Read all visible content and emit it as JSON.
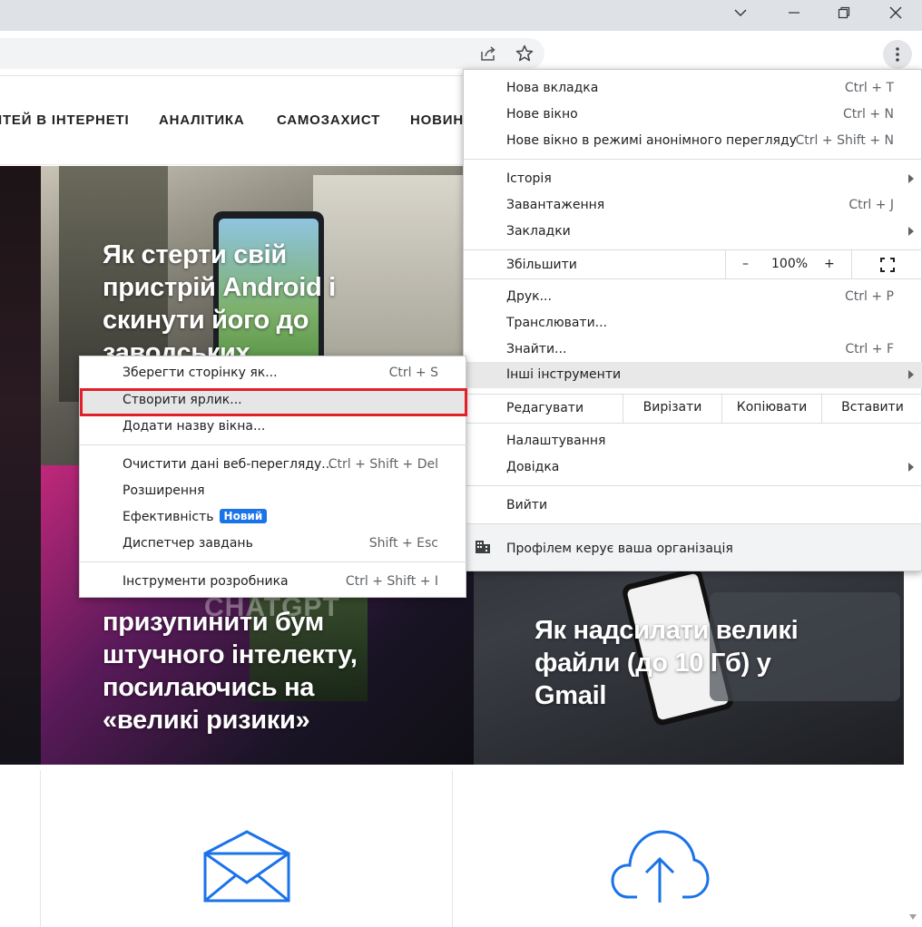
{
  "site_nav": {
    "items": [
      "ІТЕЙ В ІНТЕРНЕТІ",
      "АНАЛІТИКА",
      "САМОЗАХИСТ",
      "НОВИН"
    ]
  },
  "articles": [
    {
      "title": "Як стерти свій пристрій Android і скинути його до заводських"
    },
    {
      "title": "призупинити бум штучного інтелекту, посилаючись на «великі ризики»"
    },
    {
      "title": "Як надсилати великі файли (до 10 Гб) у Gmail"
    }
  ],
  "phone_overlay_text": "CHATGPT",
  "menu": {
    "new_tab": {
      "label": "Нова вкладка",
      "shortcut": "Ctrl + T"
    },
    "new_window": {
      "label": "Нове вікно",
      "shortcut": "Ctrl + N"
    },
    "incognito": {
      "label": "Нове вікно в режимі анонімного перегляду",
      "shortcut": "Ctrl + Shift + N"
    },
    "history": {
      "label": "Історія"
    },
    "downloads": {
      "label": "Завантаження",
      "shortcut": "Ctrl + J"
    },
    "bookmarks": {
      "label": "Закладки"
    },
    "zoom": {
      "label": "Збільшити",
      "minus": "–",
      "value": "100%",
      "plus": "+"
    },
    "print": {
      "label": "Друк...",
      "shortcut": "Ctrl + P"
    },
    "cast": {
      "label": "Транслювати..."
    },
    "find": {
      "label": "Знайти...",
      "shortcut": "Ctrl + F"
    },
    "more_tools": {
      "label": "Інші інструменти"
    },
    "edit": {
      "label": "Редагувати",
      "cut": "Вирізати",
      "copy": "Копіювати",
      "paste": "Вставити"
    },
    "settings": {
      "label": "Налаштування"
    },
    "help": {
      "label": "Довідка"
    },
    "exit": {
      "label": "Вийти"
    },
    "managed": {
      "label": "Профілем керує ваша організація"
    }
  },
  "submenu": {
    "save_page": {
      "label": "Зберегти сторінку як...",
      "shortcut": "Ctrl + S"
    },
    "create_shortcut": {
      "label": "Створити ярлик..."
    },
    "name_window": {
      "label": "Додати назву вікна..."
    },
    "clear_data": {
      "label": "Очистити дані веб-перегляду...",
      "shortcut": "Ctrl + Shift + Del"
    },
    "extensions": {
      "label": "Розширення"
    },
    "performance": {
      "label": "Ефективність",
      "badge": "Новий"
    },
    "task_manager": {
      "label": "Диспетчер завдань",
      "shortcut": "Shift + Esc"
    },
    "dev_tools": {
      "label": "Інструменти розробника",
      "shortcut": "Ctrl + Shift + I"
    }
  },
  "colors": {
    "highlight_border": "#e2202a",
    "badge": "#1a73e8",
    "icon_blue": "#1a73e8"
  },
  "icons": [
    "chevron-down-icon",
    "minimize-icon",
    "restore-icon",
    "close-icon",
    "share-icon",
    "star-icon",
    "kebab-menu-icon",
    "fullscreen-icon",
    "building-icon",
    "envelope-icon",
    "cloud-upload-icon"
  ]
}
